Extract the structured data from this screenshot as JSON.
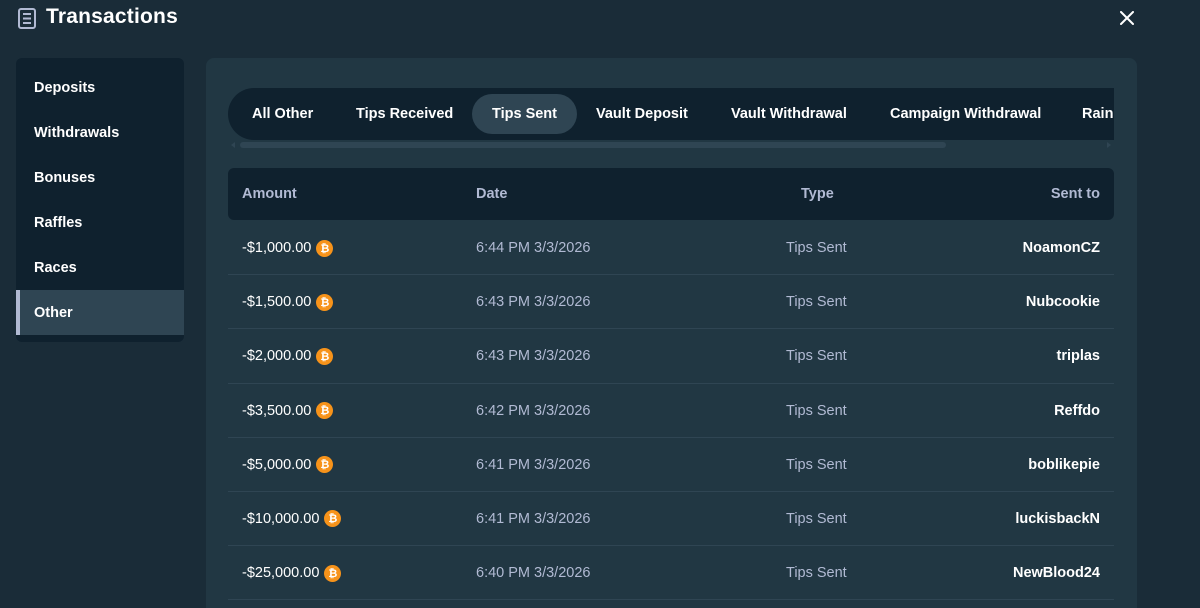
{
  "header": {
    "title": "Transactions",
    "close_icon": "close-icon",
    "title_icon": "receipt-icon"
  },
  "sidebar": {
    "items": [
      {
        "label": "Deposits",
        "active": false
      },
      {
        "label": "Withdrawals",
        "active": false
      },
      {
        "label": "Bonuses",
        "active": false
      },
      {
        "label": "Raffles",
        "active": false
      },
      {
        "label": "Races",
        "active": false
      },
      {
        "label": "Other",
        "active": true
      }
    ]
  },
  "tabs": [
    {
      "label": "All Other",
      "active": false
    },
    {
      "label": "Tips Received",
      "active": false
    },
    {
      "label": "Tips Sent",
      "active": true
    },
    {
      "label": "Vault Deposit",
      "active": false
    },
    {
      "label": "Vault Withdrawal",
      "active": false
    },
    {
      "label": "Campaign Withdrawal",
      "active": false
    },
    {
      "label": "Rain",
      "active": false
    }
  ],
  "table": {
    "headers": {
      "amount": "Amount",
      "date": "Date",
      "type": "Type",
      "sent_to": "Sent to"
    },
    "currency_icon": "bitcoin-icon",
    "rows": [
      {
        "amount": "-$1,000.00",
        "date": "6:44 PM 3/3/2026",
        "type": "Tips Sent",
        "sent_to": "NoamonCZ"
      },
      {
        "amount": "-$1,500.00",
        "date": "6:43 PM 3/3/2026",
        "type": "Tips Sent",
        "sent_to": "Nubcookie"
      },
      {
        "amount": "-$2,000.00",
        "date": "6:43 PM 3/3/2026",
        "type": "Tips Sent",
        "sent_to": "triplas"
      },
      {
        "amount": "-$3,500.00",
        "date": "6:42 PM 3/3/2026",
        "type": "Tips Sent",
        "sent_to": "Reffdo"
      },
      {
        "amount": "-$5,000.00",
        "date": "6:41 PM 3/3/2026",
        "type": "Tips Sent",
        "sent_to": "boblikepie"
      },
      {
        "amount": "-$10,000.00",
        "date": "6:41 PM 3/3/2026",
        "type": "Tips Sent",
        "sent_to": "luckisbackN"
      },
      {
        "amount": "-$25,000.00",
        "date": "6:40 PM 3/3/2026",
        "type": "Tips Sent",
        "sent_to": "NewBlood24"
      }
    ]
  },
  "colors": {
    "background": "#1a2c38",
    "panel": "#213743",
    "dark": "#0f212e",
    "active": "#2f4553",
    "muted_text": "#b1bad3",
    "bitcoin": "#f7931a"
  }
}
